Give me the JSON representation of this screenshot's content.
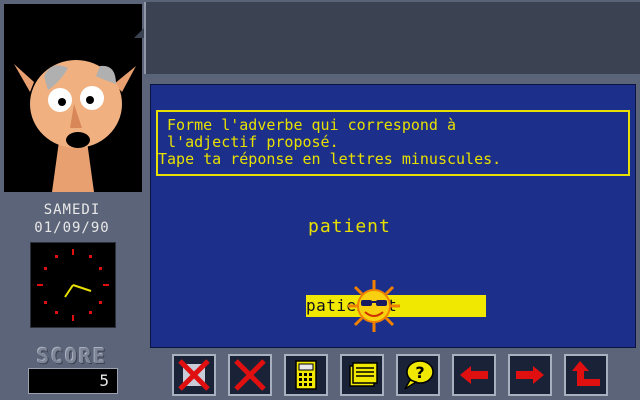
{
  "sidebar": {
    "day": "SAMEDI",
    "date": "01/09/90",
    "score_label": "SCORE",
    "score_value": "5"
  },
  "exercise": {
    "instruction_line1": " Forme l'adverbe qui correspond à",
    "instruction_line2": " l'adjectif proposé.",
    "instruction_line3": "Tape ta réponse en lettres minuscules.",
    "word": "patient",
    "answer": "patiement"
  },
  "toolbar": {
    "buttons": [
      {
        "icon": "cross-icon"
      },
      {
        "icon": "cross-icon"
      },
      {
        "icon": "calculator-icon"
      },
      {
        "icon": "notepad-icon"
      },
      {
        "icon": "help-bubble-icon"
      },
      {
        "icon": "arrow-left-icon"
      },
      {
        "icon": "arrow-right-icon"
      },
      {
        "icon": "return-arrow-icon"
      }
    ]
  },
  "colors": {
    "panel": "#5b6478",
    "main_bg": "#1c2f8a",
    "text_yellow": "#e8e000",
    "answer_bg": "#f0e800",
    "icon_red": "#e01010"
  }
}
